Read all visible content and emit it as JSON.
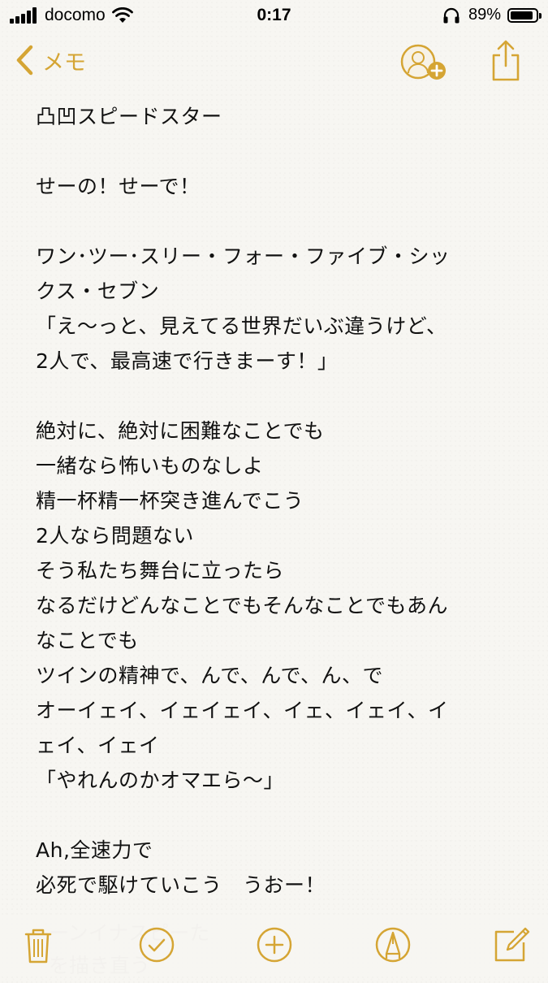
{
  "status_bar": {
    "carrier": "docomo",
    "time": "0:17",
    "battery_percent": "89%",
    "battery_level": 0.89
  },
  "nav": {
    "back_label": "メモ"
  },
  "note": {
    "lines": [
      "凸凹スピードスター",
      "",
      "せーの！せーで！",
      "",
      "ワン･ツー･スリー・フォー・ファイブ・シッ",
      "クス・セブン",
      "「え〜っと、見えてる世界だいぶ違うけど、",
      "2人で、最高速で行きまーす！」",
      "",
      "絶対に、絶対に困難なことでも",
      "一緒なら怖いものなしよ",
      "精一杯精一杯突き進んでこう",
      "2人なら問題ない",
      "そう私たち舞台に立ったら",
      "なるだけどんなことでもそんなことでもあん",
      "なことでも",
      "ツインの精神で、んで、んで、ん、で",
      "オーイェイ、イェイェイ、イェ、イェイ、イ",
      "ェイ、イェイ",
      "「やれんのかオマエら〜」",
      "",
      "Ah,全速力で",
      "必死で駆けていこう　うおー！"
    ]
  },
  "colors": {
    "accent": "#d5a534",
    "background": "#f7f6f2",
    "text": "#111111"
  },
  "icons": {
    "back": "chevron-left-icon",
    "add_person": "add-person-icon",
    "share": "share-icon",
    "trash": "trash-icon",
    "checklist": "checkmark-circle-icon",
    "add": "plus-circle-icon",
    "sketch": "pen-tip-circle-icon",
    "compose": "compose-icon"
  }
}
